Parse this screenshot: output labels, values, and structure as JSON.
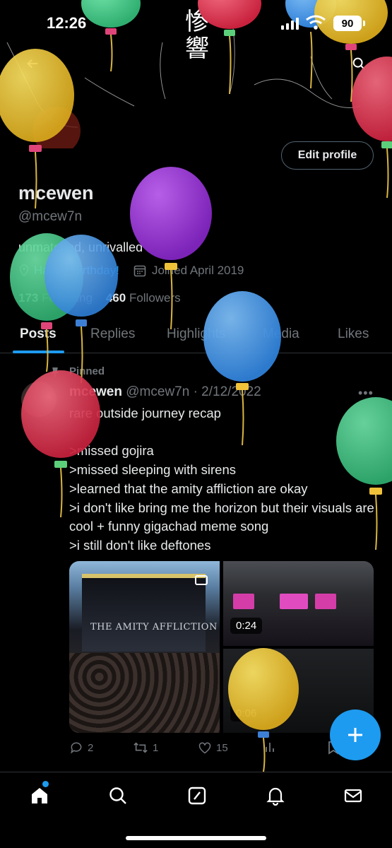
{
  "status_bar": {
    "time": "12:26",
    "battery": "90"
  },
  "banner": {
    "title": "惨響"
  },
  "profile": {
    "edit_label": "Edit profile",
    "display_name": "mcewen",
    "handle": "@mcew7n",
    "bio": "unmatched, unrivalled",
    "birthday": "Happy Birthday!",
    "joined": "Joined April 2019",
    "following_count": "173",
    "following_label": "Following",
    "followers_count": "460",
    "followers_label": "Followers"
  },
  "tabs": [
    {
      "label": "Posts",
      "active": true
    },
    {
      "label": "Replies"
    },
    {
      "label": "Highlights"
    },
    {
      "label": "Media"
    },
    {
      "label": "Likes"
    }
  ],
  "post": {
    "pinned_label": "Pinned",
    "author": "mcewen",
    "handle_date": "@mcew7n · 2/12/2022",
    "text": "rare outside journey recap\n\n>missed gojira\n>missed sleeping with sirens\n>learned that the amity affliction are okay\n>i don't like bring me the horizon but their visuals are cool + funny gigachad meme song\n>i still don't like deftones",
    "media_banner": "THE AMITY AFFLICTION",
    "video_1_duration": "0:24",
    "video_2_duration": "0:06",
    "replies": "2",
    "reposts": "1",
    "likes": "15"
  },
  "colors": {
    "accent": "#1d9bf0",
    "muted": "#71767b",
    "text": "#e7e9ea"
  },
  "icons": {
    "nav": [
      "home-icon",
      "search-icon",
      "compose-grok-icon",
      "bell-icon",
      "mail-icon"
    ],
    "post_actions": [
      "reply-icon",
      "repost-icon",
      "like-icon",
      "views-icon",
      "bookmark-icon"
    ]
  }
}
